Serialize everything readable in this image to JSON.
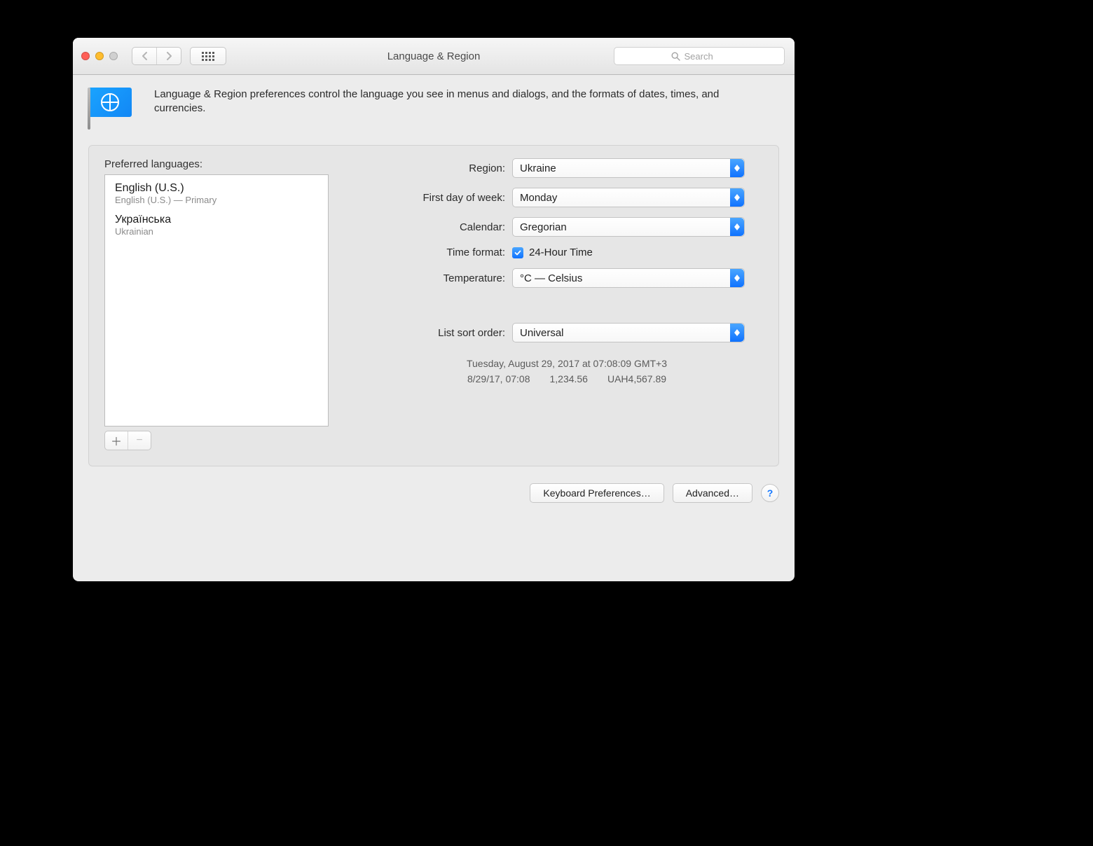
{
  "window": {
    "title": "Language & Region"
  },
  "search": {
    "placeholder": "Search"
  },
  "intro": "Language & Region preferences control the language you see in menus and dialogs, and the formats of dates, times, and currencies.",
  "languages": {
    "heading": "Preferred languages:",
    "items": [
      {
        "name": "English (U.S.)",
        "subtitle": "English (U.S.) — Primary"
      },
      {
        "name": "Українська",
        "subtitle": "Ukrainian"
      }
    ]
  },
  "form": {
    "region": {
      "label": "Region:",
      "value": "Ukraine"
    },
    "first_day": {
      "label": "First day of week:",
      "value": "Monday"
    },
    "calendar": {
      "label": "Calendar:",
      "value": "Gregorian"
    },
    "time_format": {
      "label": "Time format:",
      "checkbox_label": "24-Hour Time",
      "checked": true
    },
    "temperature": {
      "label": "Temperature:",
      "value": "°C — Celsius"
    },
    "list_sort": {
      "label": "List sort order:",
      "value": "Universal"
    }
  },
  "sample": {
    "line1": "Tuesday, August 29, 2017 at 07:08:09 GMT+3",
    "line2": "8/29/17, 07:08  1,234.56  UAH4,567.89"
  },
  "buttons": {
    "keyboard": "Keyboard Preferences…",
    "advanced": "Advanced…"
  }
}
